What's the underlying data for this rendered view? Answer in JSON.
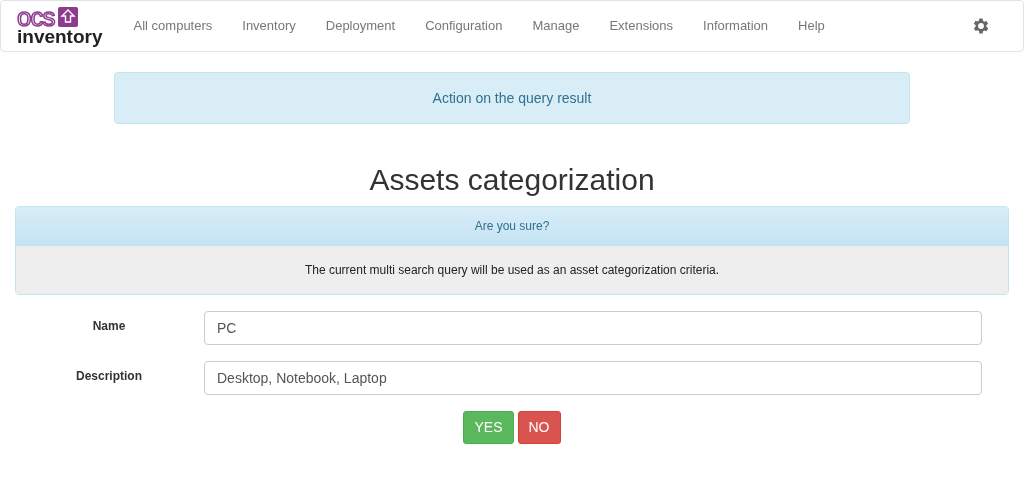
{
  "logo": {
    "top": "ocs",
    "bottom": "inventory"
  },
  "nav": [
    "All computers",
    "Inventory",
    "Deployment",
    "Configuration",
    "Manage",
    "Extensions",
    "Information",
    "Help"
  ],
  "action_banner": "Action on the query result",
  "title": "Assets categorization",
  "confirm": {
    "heading": "Are you sure?",
    "message": "The current multi search query will be used as an asset categorization criteria."
  },
  "fields": [
    {
      "label": "Name",
      "value": "PC"
    },
    {
      "label": "Description",
      "value": "Desktop, Notebook, Laptop"
    }
  ],
  "buttons": [
    {
      "label": "YES",
      "kind": "yes"
    },
    {
      "label": "NO",
      "kind": "no"
    }
  ]
}
